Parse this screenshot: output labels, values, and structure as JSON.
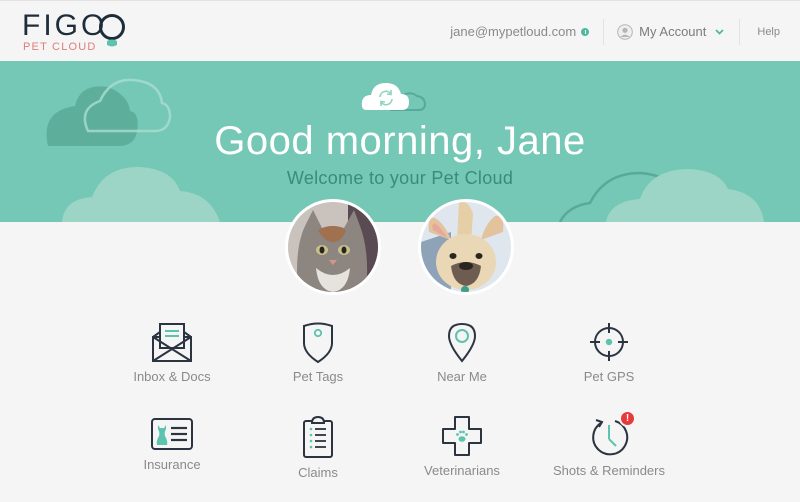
{
  "header": {
    "logo_word": "FIGO",
    "logo_sub": "PET CLOUD",
    "email": "jane@mypetloud.com",
    "account_label": "My Account",
    "help_label": "Help"
  },
  "banner": {
    "greeting": "Good morning, Jane",
    "subtitle": "Welcome to your Pet Cloud"
  },
  "pets": [
    {
      "name": "cat",
      "kind": "cat"
    },
    {
      "name": "dog",
      "kind": "french-bulldog"
    }
  ],
  "tiles": [
    {
      "label": "Inbox & Docs",
      "icon": "envelope-icon"
    },
    {
      "label": "Pet Tags",
      "icon": "pet-tag-icon"
    },
    {
      "label": "Near Me",
      "icon": "map-pin-icon"
    },
    {
      "label": "Pet GPS",
      "icon": "crosshair-icon"
    },
    {
      "label": "Insurance",
      "icon": "insurance-card-icon"
    },
    {
      "label": "Claims",
      "icon": "clipboard-icon"
    },
    {
      "label": "Veterinarians",
      "icon": "vet-cross-icon"
    },
    {
      "label": "Shots & Reminders",
      "icon": "clock-reminder-icon",
      "alert_badge": "!"
    }
  ],
  "colors": {
    "brand_teal": "#75c8b5",
    "accent_teal": "#5cc4ae",
    "icon_dark": "#2b3440",
    "alert_red": "#e53b3b",
    "logo_pink": "#e07c7c"
  }
}
